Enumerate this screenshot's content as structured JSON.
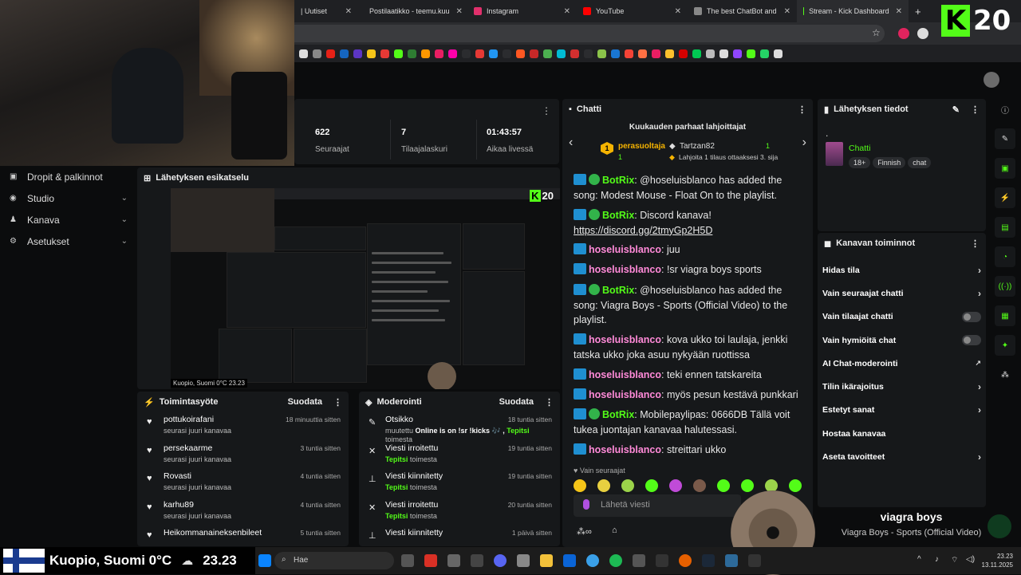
{
  "browser": {
    "tabs": [
      {
        "label": "| Uutiset",
        "color": "#444"
      },
      {
        "label": "Postilaatikko - teemu.kuu",
        "color": "#ea4335"
      },
      {
        "label": "Instagram",
        "color": "#e1306c"
      },
      {
        "label": "YouTube",
        "color": "#ff0000"
      },
      {
        "label": "The best ChatBot and",
        "color": "#888"
      },
      {
        "label": "Stream - Kick Dashboard",
        "color": "#53fc18"
      }
    ],
    "new_tab": "+"
  },
  "overlay": {
    "kick_logo": "K",
    "viewer_number": "20"
  },
  "stats": [
    {
      "value": "622",
      "label": "Seuraajat"
    },
    {
      "value": "7",
      "label": "Tilaajalaskuri"
    },
    {
      "value": "01:43:57",
      "label": "Aikaa livessä"
    }
  ],
  "sidebar": {
    "items": [
      {
        "label": "Dropit & palkinnot",
        "icon": "gift-icon"
      },
      {
        "label": "Studio",
        "icon": "camera-icon"
      },
      {
        "label": "Kanava",
        "icon": "user-icon"
      },
      {
        "label": "Asetukset",
        "icon": "gear-icon"
      }
    ]
  },
  "preview": {
    "title": "Lähetyksen esikatselu"
  },
  "preview_location": "Kuopio, Suomi 0°C   23.23",
  "activity": {
    "title": "Toimintasyöte",
    "filter": "Suodata",
    "items": [
      {
        "user": "pottukoirafani",
        "action": "seurasi juuri kanavaa",
        "time": "18 minuuttia sitten"
      },
      {
        "user": "persekaarme",
        "action": "seurasi juuri kanavaa",
        "time": "3 tuntia sitten"
      },
      {
        "user": "Rovasti",
        "action": "seurasi juuri kanavaa",
        "time": "4 tuntia sitten"
      },
      {
        "user": "karhu89",
        "action": "seurasi juuri kanavaa",
        "time": "4 tuntia sitten"
      },
      {
        "user": "Heikommanaineksenbileet",
        "action": "",
        "time": "5 tuntia sitten"
      }
    ]
  },
  "moderation": {
    "title": "Moderointi",
    "filter": "Suodata",
    "items": [
      {
        "title": "Otsikko",
        "sub_prefix": "muutettu ",
        "sub_bold": "Online is on !sr !kicks 🎶 , ",
        "sub_mod": "Tepitsi",
        "sub_suffix": " toimesta",
        "time": "18 tuntia sitten",
        "icon": "edit-icon"
      },
      {
        "title": "Viesti irroitettu",
        "sub_prefix": "",
        "sub_bold": "",
        "sub_mod": "Tepitsi",
        "sub_suffix": " toimesta",
        "time": "19 tuntia sitten",
        "icon": "unpin-icon"
      },
      {
        "title": "Viesti kiinnitetty",
        "sub_prefix": "",
        "sub_bold": "",
        "sub_mod": "Tepitsi",
        "sub_suffix": " toimesta",
        "time": "19 tuntia sitten",
        "icon": "pin-icon"
      },
      {
        "title": "Viesti irroitettu",
        "sub_prefix": "",
        "sub_bold": "",
        "sub_mod": "Tepitsi",
        "sub_suffix": " toimesta",
        "time": "20 tuntia sitten",
        "icon": "unpin-icon"
      },
      {
        "title": "Viesti kiinnitetty",
        "sub_prefix": "",
        "sub_bold": "",
        "sub_mod": "",
        "sub_suffix": "",
        "time": "1 päivä sitten",
        "icon": "pin-icon"
      }
    ]
  },
  "chat": {
    "title": "Chatti",
    "top_gifters_title": "Kuukauden parhaat lahjoittajat",
    "gifter1": {
      "rank": "1",
      "name": "perasuoltaja",
      "count": "1"
    },
    "gifter2": {
      "name": "Tartzan82",
      "count": "1"
    },
    "gift_note": "Lahjoita 1 tilaus ottaaksesi 3. sija",
    "messages": [
      {
        "user": "BotRix",
        "text": "@hoseluisblanco has added the song: Modest Mouse - Float On to the playlist.",
        "bot": true
      },
      {
        "user": "BotRix",
        "text": "Discord kanava!",
        "link": "https://discord.gg/2tmyGp2H5D",
        "bot": true
      },
      {
        "user": "hoseluisblanco",
        "text": "juu",
        "bot": false
      },
      {
        "user": "hoseluisblanco",
        "text": "!sr viagra boys sports",
        "bot": false
      },
      {
        "user": "BotRix",
        "text": "@hoseluisblanco has added the song: Viagra Boys - Sports (Official Video) to the playlist.",
        "bot": true
      },
      {
        "user": "hoseluisblanco",
        "text": "kova ukko toi laulaja, jenkki tatska ukko joka asuu nykyään ruottissa",
        "bot": false
      },
      {
        "user": "hoseluisblanco",
        "text": "teki ennen tatskareita",
        "bot": false
      },
      {
        "user": "hoseluisblanco",
        "text": "myös pesun kestävä punkkari",
        "bot": false
      },
      {
        "user": "BotRix",
        "text": "Mobilepaylipas: 0666DB Tällä voit tukea juontajan kanavaa halutessasi.",
        "bot": true
      },
      {
        "user": "hoseluisblanco",
        "text": "streittari ukko",
        "bot": false
      }
    ],
    "followers_only": "Vain seuraajat",
    "input_placeholder": "Lähetä viesti"
  },
  "stream_info": {
    "title": "Lähetyksen tiedot",
    "dot": ".",
    "category": "Chatti",
    "tags": [
      "18+",
      "Finnish",
      "chat"
    ]
  },
  "channel_actions": {
    "title": "Kanavan toiminnot",
    "items": [
      {
        "label": "Hidas tila",
        "type": "chevron"
      },
      {
        "label": "Vain seuraajat chatti",
        "type": "chevron"
      },
      {
        "label": "Vain tilaajat chatti",
        "type": "toggle"
      },
      {
        "label": "Vain hymiöitä chat",
        "type": "toggle"
      },
      {
        "label": "AI Chat-moderointi",
        "type": "external"
      },
      {
        "label": "Tilin ikärajoitus",
        "type": "chevron"
      },
      {
        "label": "Estetyt sanat",
        "type": "chevron"
      },
      {
        "label": "Hostaa kanavaa",
        "type": "none"
      },
      {
        "label": "Aseta tavoitteet",
        "type": "chevron"
      }
    ]
  },
  "now_playing": {
    "artist": "viagra boys",
    "track": "Viagra Boys - Sports (Official Video)"
  },
  "taskbar": {
    "weather": "Kuopio, Suomi 0°C",
    "clock_overlay": "23.23",
    "search_placeholder": "Hae",
    "time": "23.23",
    "date": "13.11.2025"
  },
  "colors": {
    "kick_green": "#53fc18",
    "chat_user": "#ff8ad8",
    "panel_bg": "#16181a"
  }
}
